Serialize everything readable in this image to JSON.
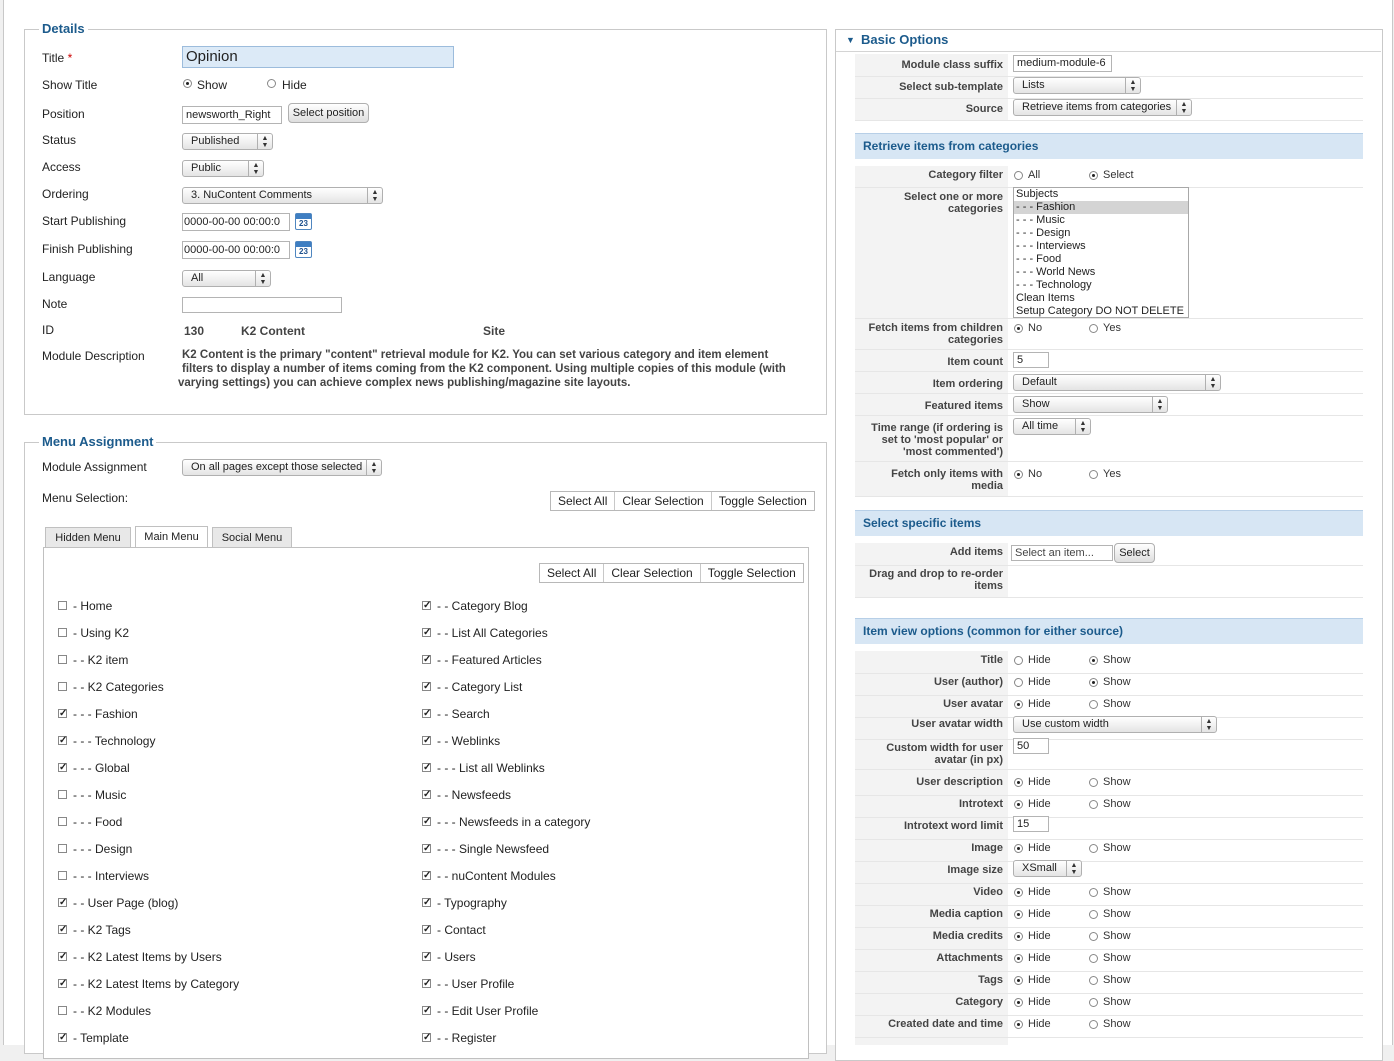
{
  "details": {
    "legend": "Details",
    "fields": {
      "title_label": "Title",
      "title_req": "*",
      "title_value": "Opinion",
      "show_title_label": "Show Title",
      "show_label": "Show",
      "hide_label": "Hide",
      "position_label": "Position",
      "position_value": "newsworth_Right",
      "select_position": "Select position",
      "status_label": "Status",
      "status_value": "Published",
      "access_label": "Access",
      "access_value": "Public",
      "ordering_label": "Ordering",
      "ordering_value": "3. NuContent Comments",
      "start_label": "Start Publishing",
      "start_value": "0000-00-00 00:00:0",
      "finish_label": "Finish Publishing",
      "finish_value": "0000-00-00 00:00:0",
      "calendar_day": "23",
      "language_label": "Language",
      "language_value": "All",
      "note_label": "Note",
      "note_value": "",
      "id_label": "ID",
      "id_value": "130",
      "id_type": "K2 Content",
      "id_site": "Site",
      "desc_label": "Module Description",
      "desc_l1": "K2 Content is the primary \"content\" retrieval module for K2. You can set various category and item element",
      "desc_l2": "filters to display a number of items coming from the K2 component. Using multiple copies of this module (with",
      "desc_l3": "varying settings) you can achieve complex news publishing/magazine site layouts."
    }
  },
  "menu": {
    "legend": "Menu Assignment",
    "module_assignment_label": "Module Assignment",
    "module_assignment_value": "On all pages except those selected",
    "menu_selection_label": "Menu Selection:",
    "select_all": "Select All",
    "clear_selection": "Clear Selection",
    "toggle_selection": "Toggle Selection",
    "tabs": [
      "Hidden Menu",
      "Main Menu",
      "Social Menu"
    ],
    "left_items": [
      {
        "label": "- Home",
        "checked": false
      },
      {
        "label": "- Using K2",
        "checked": false
      },
      {
        "label": "- - K2 item",
        "checked": false
      },
      {
        "label": "- - K2 Categories",
        "checked": false
      },
      {
        "label": "- - - Fashion",
        "checked": true
      },
      {
        "label": "- - - Technology",
        "checked": true
      },
      {
        "label": "- - - Global",
        "checked": true
      },
      {
        "label": "- - - Music",
        "checked": false
      },
      {
        "label": "- - - Food",
        "checked": false
      },
      {
        "label": "- - - Design",
        "checked": false
      },
      {
        "label": "- - - Interviews",
        "checked": false
      },
      {
        "label": "- - User Page (blog)",
        "checked": true
      },
      {
        "label": "- - K2 Tags",
        "checked": true
      },
      {
        "label": "- - K2 Latest Items by Users",
        "checked": true
      },
      {
        "label": "- - K2 Latest Items by Category",
        "checked": true
      },
      {
        "label": "- - K2 Modules",
        "checked": false
      },
      {
        "label": "- Template",
        "checked": true
      }
    ],
    "right_items": [
      {
        "label": "- - Category Blog",
        "checked": true
      },
      {
        "label": "- - List All Categories",
        "checked": true
      },
      {
        "label": "- - Featured Articles",
        "checked": true
      },
      {
        "label": "- - Category List",
        "checked": true
      },
      {
        "label": "- - Search",
        "checked": true
      },
      {
        "label": "- - Weblinks",
        "checked": true
      },
      {
        "label": "- - - List all Weblinks",
        "checked": true
      },
      {
        "label": "- - Newsfeeds",
        "checked": true
      },
      {
        "label": "- - - Newsfeeds in a category",
        "checked": true
      },
      {
        "label": "- - - Single Newsfeed",
        "checked": true
      },
      {
        "label": "- - nuContent Modules",
        "checked": true
      },
      {
        "label": "- Typography",
        "checked": true
      },
      {
        "label": "- Contact",
        "checked": true
      },
      {
        "label": "- Users",
        "checked": true
      },
      {
        "label": "- - User Profile",
        "checked": true
      },
      {
        "label": "- - Edit User Profile",
        "checked": true
      },
      {
        "label": "- - Register",
        "checked": true
      }
    ]
  },
  "basic": {
    "header": "Basic Options",
    "suffix_label": "Module class suffix",
    "suffix_value": "medium-module-6",
    "subtemplate_label": "Select sub-template",
    "subtemplate_value": "Lists",
    "source_label": "Source",
    "source_value": "Retrieve items from categories",
    "sec_retrieve": "Retrieve items from categories",
    "cat_filter_label": "Category filter",
    "all_label": "All",
    "select_label": "Select",
    "select_cats_l1": "Select one or more",
    "select_cats_l2": "categories",
    "categories": [
      {
        "label": "Subjects",
        "hl": false
      },
      {
        "label": "- - - Fashion",
        "hl": true
      },
      {
        "label": "- - - Music",
        "hl": false
      },
      {
        "label": "- - - Design",
        "hl": false
      },
      {
        "label": "- - - Interviews",
        "hl": false
      },
      {
        "label": "- - - Food",
        "hl": false
      },
      {
        "label": "- - - World News",
        "hl": false
      },
      {
        "label": "- - - Technology",
        "hl": false
      },
      {
        "label": "Clean Items",
        "hl": false
      },
      {
        "label": "Setup Category DO NOT DELETE",
        "hl": false
      }
    ],
    "fetch_children_l1": "Fetch items from children",
    "fetch_children_l2": "categories",
    "no_label": "No",
    "yes_label": "Yes",
    "item_count_label": "Item count",
    "item_count_value": "5",
    "item_ordering_label": "Item ordering",
    "item_ordering_value": "Default",
    "featured_label": "Featured items",
    "featured_value": "Show",
    "time_range_l1": "Time range (if ordering is",
    "time_range_l2": "set to 'most popular' or",
    "time_range_l3": "'most commented')",
    "time_range_value": "All time",
    "media_only_l1": "Fetch only items with",
    "media_only_l2": "media",
    "sec_specific": "Select specific items",
    "add_items_label": "Add items",
    "add_items_placeholder": "Select an item...",
    "select_btn": "Select",
    "drag_l1": "Drag and drop to re-order",
    "drag_l2": "items",
    "sec_itemview": "Item view options (common for either source)",
    "hide_label": "Hide",
    "show_label": "Show",
    "title_label": "Title",
    "user_author_label": "User (author)",
    "user_avatar_label": "User avatar",
    "avatar_width_label": "User avatar width",
    "avatar_width_value": "Use custom width",
    "custom_width_l1": "Custom width for user",
    "custom_width_l2": "avatar (in px)",
    "custom_width_value": "50",
    "user_desc_label": "User description",
    "introtext_label": "Introtext",
    "introtext_limit_label": "Introtext word limit",
    "introtext_limit_value": "15",
    "image_label": "Image",
    "image_size_label": "Image size",
    "image_size_value": "XSmall",
    "video_label": "Video",
    "media_caption_label": "Media caption",
    "media_credits_label": "Media credits",
    "attachments_label": "Attachments",
    "tags_label": "Tags",
    "category_label": "Category",
    "created_label": "Created date and time"
  }
}
